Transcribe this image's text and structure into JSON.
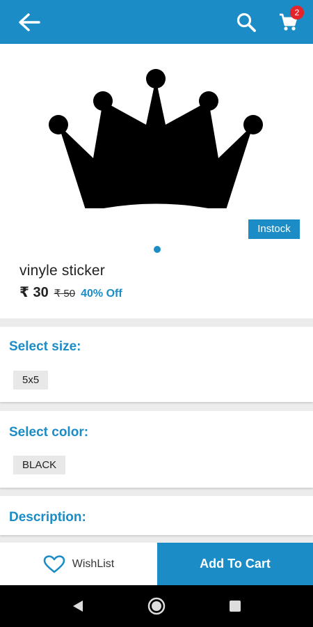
{
  "header": {
    "back_icon": "arrow-left-icon",
    "search_icon": "search-icon",
    "cart_icon": "cart-icon",
    "cart_count": "2",
    "bar_color": "#1b8cc6",
    "badge_color": "#e5232a"
  },
  "product": {
    "image_icon": "crown-icon",
    "stock_label": "Instock",
    "name": "vinyle sticker",
    "price": "₹ 30",
    "mrp": "₹ 50",
    "discount": "40% Off"
  },
  "size": {
    "heading": "Select size:",
    "selected": "5x5"
  },
  "color": {
    "heading": "Select color:",
    "selected": "BLACK"
  },
  "description": {
    "heading": "Description:"
  },
  "actions": {
    "wishlist_icon": "heart-icon",
    "wishlist_label": "WishList",
    "add_to_cart_label": "Add To Cart"
  },
  "system_nav": {
    "back_icon": "triangle-back-icon",
    "home_icon": "circle-home-icon",
    "recents_icon": "square-recents-icon"
  }
}
